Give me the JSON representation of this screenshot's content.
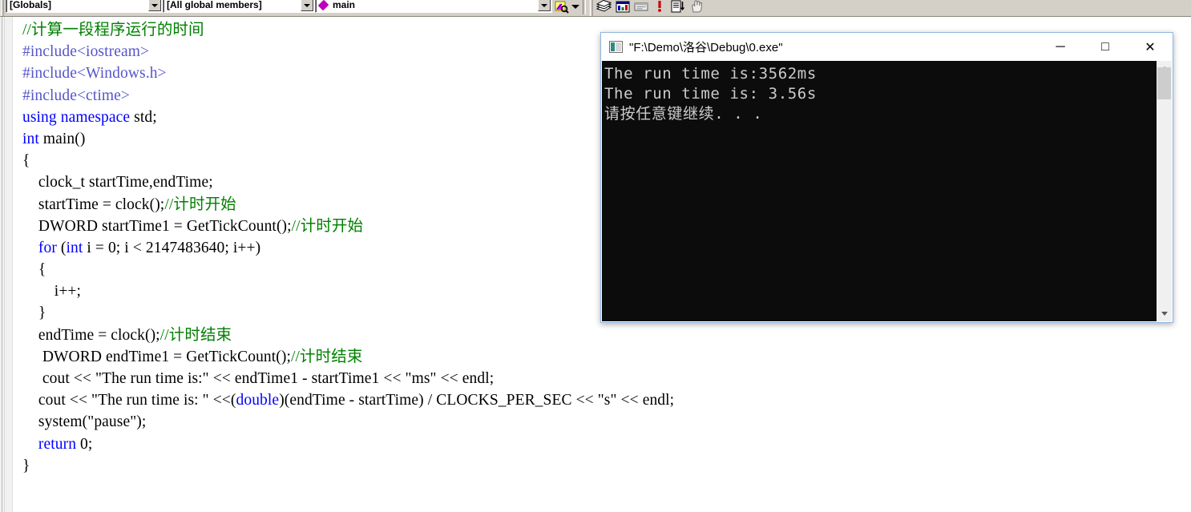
{
  "toolbar": {
    "class_combo": "[Globals]",
    "members_combo": "[All global members]",
    "symbol_combo": "main",
    "icons": [
      "find-in-files-icon",
      "dropdown-arrow-icon",
      "books-icon",
      "resource-view-icon",
      "workspace-icon",
      "error-marker-icon",
      "output-list-icon",
      "hand-pointer-icon"
    ]
  },
  "editor": {
    "language": "cpp",
    "lines": [
      {
        "indent": 0,
        "segs": [
          {
            "t": "//计算一段程序运行的时间",
            "c": "cmt"
          }
        ]
      },
      {
        "indent": 0,
        "segs": [
          {
            "t": "#include",
            "c": "pre"
          },
          {
            "t": "<iostream>",
            "c": "pre"
          }
        ]
      },
      {
        "indent": 0,
        "segs": [
          {
            "t": "#include",
            "c": "pre"
          },
          {
            "t": "<Windows.h>",
            "c": "pre"
          }
        ]
      },
      {
        "indent": 0,
        "segs": [
          {
            "t": "#include",
            "c": "pre"
          },
          {
            "t": "<ctime>",
            "c": "pre"
          }
        ]
      },
      {
        "indent": 0,
        "segs": [
          {
            "t": "using namespace",
            "c": "kw"
          },
          {
            "t": " std;",
            "c": "plain"
          }
        ]
      },
      {
        "indent": 0,
        "segs": [
          {
            "t": "int",
            "c": "kw"
          },
          {
            "t": " main()",
            "c": "plain"
          }
        ]
      },
      {
        "indent": 0,
        "segs": [
          {
            "t": "{",
            "c": "plain"
          }
        ]
      },
      {
        "indent": 0,
        "segs": [
          {
            "t": "    clock_t startTime,endTime;",
            "c": "plain"
          }
        ]
      },
      {
        "indent": 0,
        "segs": [
          {
            "t": "    startTime = clock();",
            "c": "plain"
          },
          {
            "t": "//计时开始",
            "c": "cmt"
          }
        ]
      },
      {
        "indent": 0,
        "segs": [
          {
            "t": "    DWORD startTime1 = GetTickCount();",
            "c": "plain"
          },
          {
            "t": "//计时开始",
            "c": "cmt"
          }
        ]
      },
      {
        "indent": 0,
        "segs": [
          {
            "t": "    ",
            "c": "plain"
          },
          {
            "t": "for",
            "c": "kw"
          },
          {
            "t": " (",
            "c": "plain"
          },
          {
            "t": "int",
            "c": "kw"
          },
          {
            "t": " i = 0; i < 2147483640; i++)",
            "c": "plain"
          }
        ]
      },
      {
        "indent": 0,
        "segs": [
          {
            "t": "    {",
            "c": "plain"
          }
        ]
      },
      {
        "indent": 0,
        "segs": [
          {
            "t": "        i++;",
            "c": "plain"
          }
        ]
      },
      {
        "indent": 0,
        "segs": [
          {
            "t": "    }",
            "c": "plain"
          }
        ]
      },
      {
        "indent": 0,
        "segs": [
          {
            "t": "    endTime = clock();",
            "c": "plain"
          },
          {
            "t": "//计时结束",
            "c": "cmt"
          }
        ]
      },
      {
        "indent": 0,
        "segs": [
          {
            "t": "     DWORD endTime1 = GetTickCount();",
            "c": "plain"
          },
          {
            "t": "//计时结束",
            "c": "cmt"
          }
        ]
      },
      {
        "indent": 0,
        "segs": [
          {
            "t": "     cout << \"The run time is:\" << endTime1 - startTime1 << \"ms\" << endl;",
            "c": "plain"
          }
        ]
      },
      {
        "indent": 0,
        "segs": [
          {
            "t": "    cout << \"The run time is: \" <<(",
            "c": "plain"
          },
          {
            "t": "double",
            "c": "kw"
          },
          {
            "t": ")(endTime - startTime) / CLOCKS_PER_SEC << \"s\" << endl;",
            "c": "plain"
          }
        ]
      },
      {
        "indent": 0,
        "segs": [
          {
            "t": "    system(\"pause\");",
            "c": "plain"
          }
        ]
      },
      {
        "indent": 0,
        "segs": [
          {
            "t": "    ",
            "c": "plain"
          },
          {
            "t": "return",
            "c": "kw"
          },
          {
            "t": " 0;",
            "c": "plain"
          }
        ]
      },
      {
        "indent": 0,
        "segs": [
          {
            "t": "}",
            "c": "plain"
          }
        ]
      }
    ]
  },
  "console": {
    "title": "\"F:\\Demo\\洛谷\\Debug\\0.exe\"",
    "minimize_label": "─",
    "maximize_label": "□",
    "close_label": "✕",
    "output_lines": [
      "The run time is:3562ms",
      "The run time is: 3.56s",
      "请按任意键继续. . ."
    ],
    "scrollbar": {
      "up_label": "up-arrow",
      "down_label": "down-arrow"
    }
  },
  "colors": {
    "comment": "#008000",
    "keyword": "#0000ff",
    "preprocessor": "#5555cc",
    "console_bg": "#0c0c0c",
    "console_fg": "#cccccc",
    "toolbar_bg": "#d4d0c8",
    "symbol_marker": "#c000c0"
  }
}
